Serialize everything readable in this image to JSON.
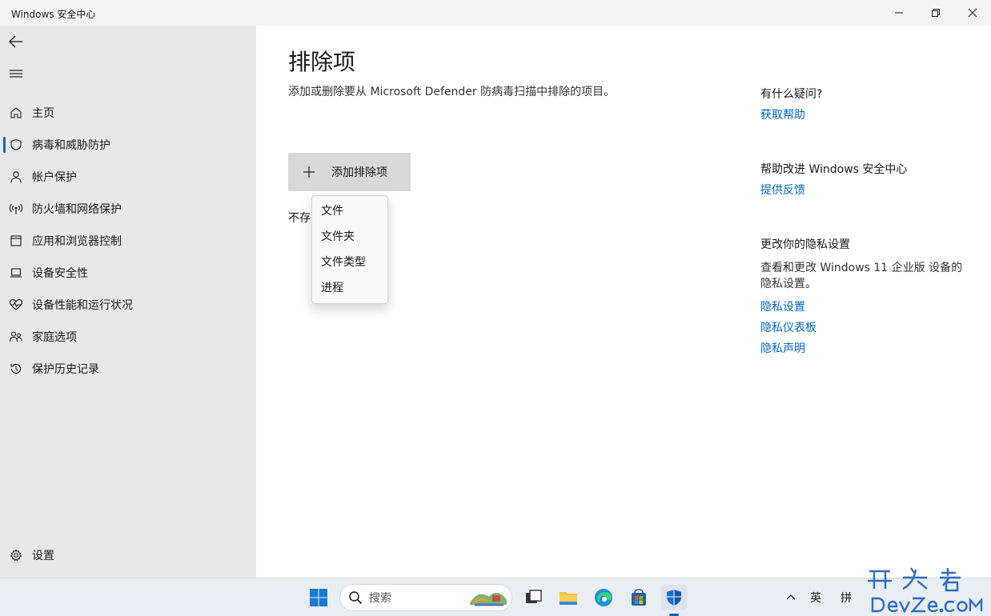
{
  "window": {
    "title": "Windows 安全中心"
  },
  "sidebar": {
    "items": [
      {
        "label": "主页",
        "icon": "home-icon"
      },
      {
        "label": "病毒和威胁防护",
        "icon": "shield-icon",
        "active": true
      },
      {
        "label": "帐户保护",
        "icon": "person-icon"
      },
      {
        "label": "防火墙和网络保护",
        "icon": "wireless-icon"
      },
      {
        "label": "应用和浏览器控制",
        "icon": "app-window-icon"
      },
      {
        "label": "设备安全性",
        "icon": "laptop-icon"
      },
      {
        "label": "设备性能和运行状况",
        "icon": "heart-pulse-icon"
      },
      {
        "label": "家庭选项",
        "icon": "family-icon"
      },
      {
        "label": "保护历史记录",
        "icon": "history-icon"
      }
    ],
    "settings_label": "设置"
  },
  "main": {
    "title": "排除项",
    "description": "添加或删除要从 Microsoft Defender 防病毒扫描中排除的项目。",
    "add_button_label": "添加排除项",
    "no_items_text": "不存",
    "dropdown": [
      "文件",
      "文件夹",
      "文件类型",
      "进程"
    ]
  },
  "side_panel": {
    "question_heading": "有什么疑问?",
    "get_help": "获取帮助",
    "improve_heading": "帮助改进 Windows 安全中心",
    "feedback": "提供反馈",
    "privacy_heading": "更改你的隐私设置",
    "privacy_text": "查看和更改 Windows 11 企业版 设备的隐私设置。",
    "privacy_settings": "隐私设置",
    "privacy_dashboard": "隐私仪表板",
    "privacy_statement": "隐私声明"
  },
  "taskbar": {
    "search_placeholder": "搜索",
    "tray_lang": "英",
    "tray_ime": "拼"
  },
  "colors": {
    "accent": "#0067c0",
    "sidebar_bg": "#e8e8e8",
    "button_bg": "#d9d9d9"
  }
}
